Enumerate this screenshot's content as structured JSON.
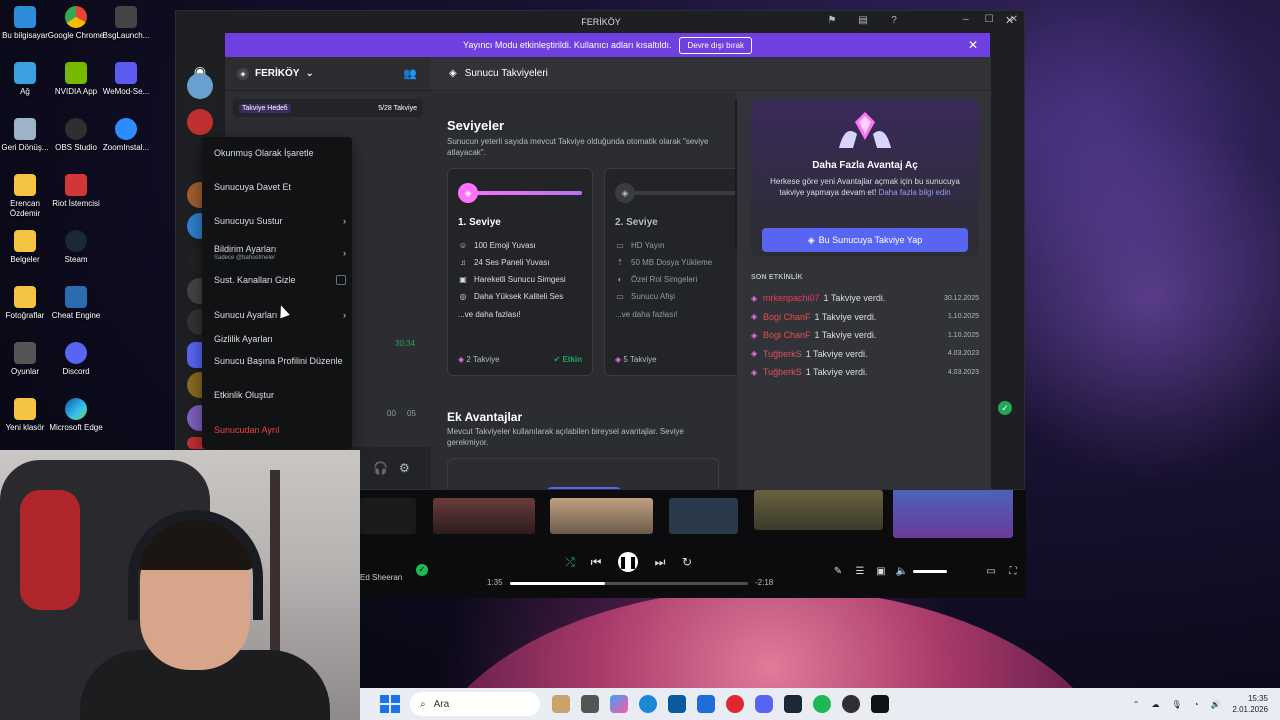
{
  "desktop": {
    "icons": [
      {
        "label": "Bu bilgisayar"
      },
      {
        "label": "Google Chrome"
      },
      {
        "label": "BsgLaunch..."
      },
      {
        "label": "Ağ"
      },
      {
        "label": "NVIDIA App"
      },
      {
        "label": "WeMod-Se..."
      },
      {
        "label": "Geri Dönüş..."
      },
      {
        "label": "OBS Studio"
      },
      {
        "label": "ZoomInstal..."
      },
      {
        "label": "Erencan Özdemir"
      },
      {
        "label": "Riot İstemcisi"
      },
      {
        "label": "Belgeler"
      },
      {
        "label": "Steam"
      },
      {
        "label": "Fotoğraflar"
      },
      {
        "label": "Cheat Engine"
      },
      {
        "label": "Oyunlar"
      },
      {
        "label": "Discord"
      },
      {
        "label": "Yeni klasör"
      },
      {
        "label": "Microsoft Edge"
      }
    ]
  },
  "window": {
    "title": "FERİKÖY",
    "banner_text": "Yayıncı Modu etkinleştirildi. Kullanıcı adları kısaltıldı.",
    "banner_button": "Devre dışı bırak"
  },
  "server": {
    "name": "FERİKÖY",
    "goal_label": "Takviye Hedefi",
    "goal_count": "5/28 Takviye",
    "voice_time": "30:34",
    "time_a": "00",
    "time_b": "05"
  },
  "main": {
    "header": "Sunucu Takviyeleri",
    "levels_title": "Seviyeler",
    "levels_desc": "Sunucun yeterli sayıda mevcut Takviye olduğunda otomatik olarak \"seviye atlayacak\".",
    "level1": {
      "title": "1. Seviye",
      "perks": [
        "100 Emoji Yuvası",
        "24 Ses Paneli Yuvası",
        "Hareketli Sunucu Simgesi",
        "Daha Yüksek Kaliteli Ses",
        "...ve daha fazlası!"
      ],
      "foot": "2 Takviye",
      "status": "Etkin",
      "progress": 1.0
    },
    "level2": {
      "title": "2. Seviye",
      "perks": [
        "HD Yayın",
        "50 MB Dosya Yükleme",
        "Özel Rol Simgeleri",
        "Sunucu Afişi",
        "...ve daha fazlası!"
      ],
      "foot": "5 Takviye"
    },
    "extra_title": "Ek Avantajlar",
    "extra_desc": "Mevcut Takviyeler kullanılarak açılabilen bireysel avantajlar. Seviye gerekmiyor."
  },
  "promo": {
    "title": "Daha Fazla Avantaj Aç",
    "desc": "Herkese göre yeni Avantajlar açmak için bu sunucuya takviye yapmaya devam et!",
    "link": "Daha fazla bilgi edin",
    "button": "Bu Sunucuya Takviye Yap"
  },
  "recent": {
    "heading": "SON ETKİNLİK",
    "rows": [
      {
        "user": "mrkenpachi07",
        "action": "1 Takviye verdi.",
        "date": "30.12.2025"
      },
      {
        "user": "Bogi ChanF",
        "action": "1 Takviye verdi.",
        "date": "1.10.2025"
      },
      {
        "user": "Bogi ChanF",
        "action": "1 Takviye verdi.",
        "date": "1.10.2025"
      },
      {
        "user": "TuğberkS",
        "action": "1 Takviye verdi.",
        "date": "4.03.2023"
      },
      {
        "user": "TuğberkS",
        "action": "1 Takviye verdi.",
        "date": "4.03.2023"
      }
    ]
  },
  "context_menu": {
    "items": {
      "mark_read": "Okunmuş Olarak İşaretle",
      "invite": "Sunucuya Davet Et",
      "mute": "Sunucuyu Sustur",
      "notif": "Bildirim Ayarları",
      "notif_sub": "Sadece @bahsetmeler",
      "hide_muted": "Sust. Kanalları Gizle",
      "server_settings": "Sunucu Ayarları",
      "privacy": "Gizlilik Ayarları",
      "edit_profile": "Sunucu Başına Profilini Düzenle",
      "create_event": "Etkinlik Oluştur",
      "leave": "Sunucudan Ayrıl"
    }
  },
  "player": {
    "artist": "Ed Sheeran",
    "elapsed": "1:35",
    "remaining": "-2:18",
    "progress": 0.4
  },
  "taskbar": {
    "search_placeholder": "Ara",
    "time": "15:35",
    "date": "2.01.2026"
  },
  "colors": {
    "discord_bg": "#1e1f22",
    "banner": "#6f3fe0",
    "blurple": "#5865f2",
    "nitro_pink": "#ff73fa",
    "green": "#23a55a",
    "danger": "#f23f42"
  }
}
